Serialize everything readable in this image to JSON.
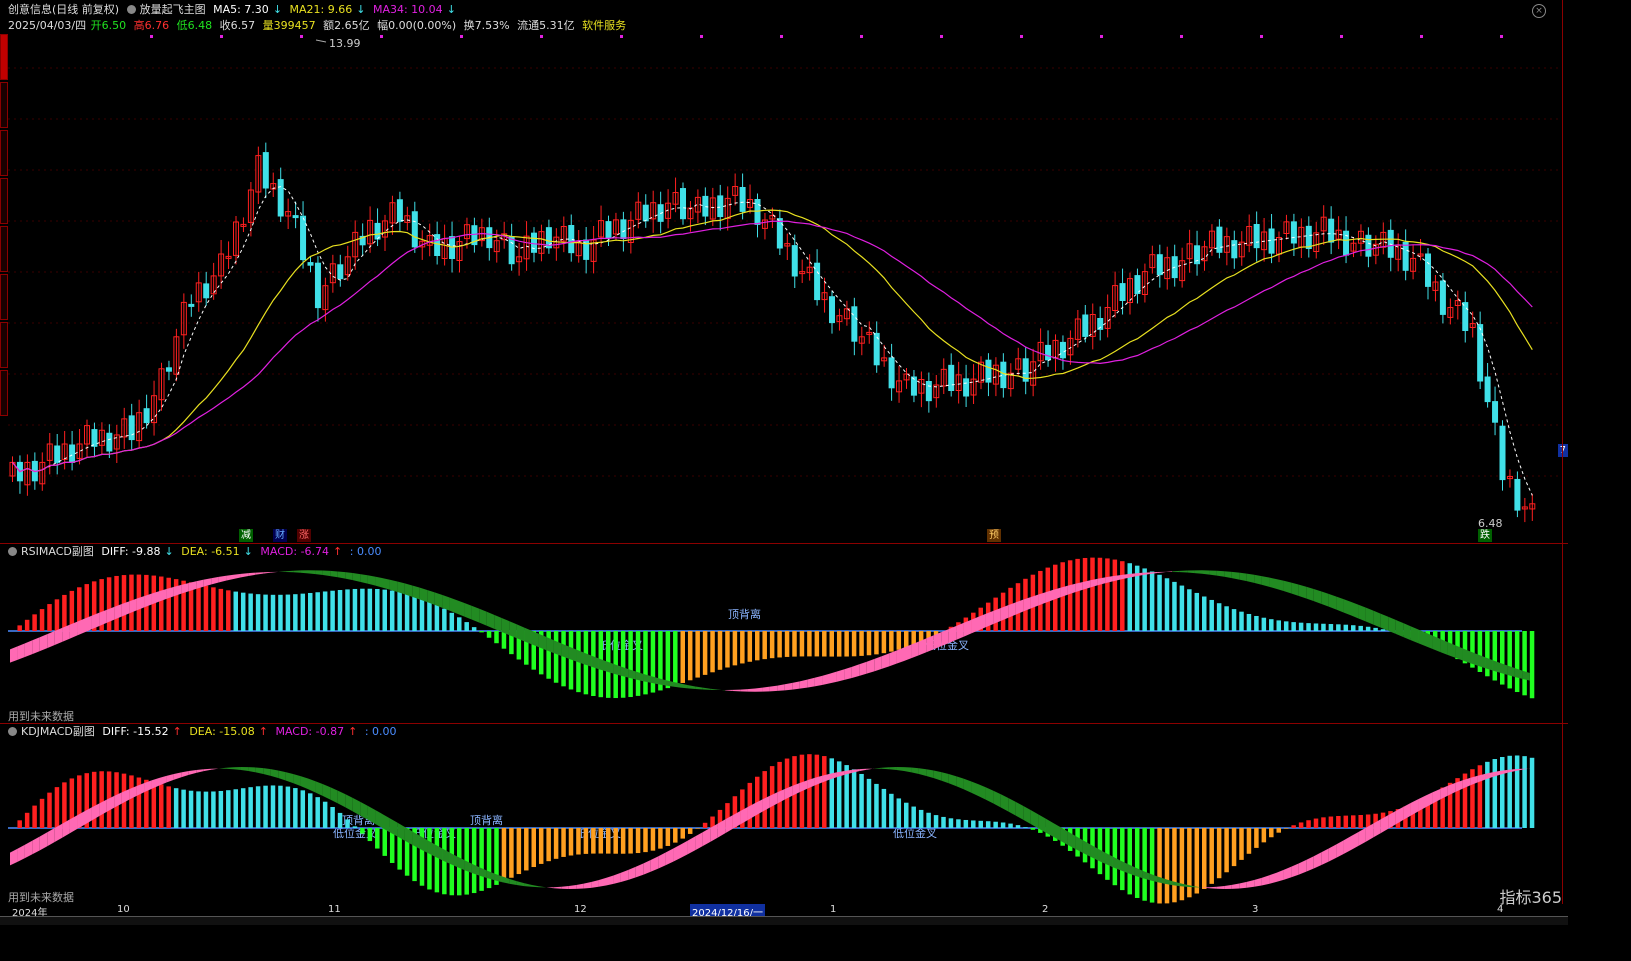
{
  "main": {
    "stock_name": "创意信息(日线 前复权)",
    "indicator_name": "放量起飞主图",
    "ma5": "MA5: 7.30",
    "ma21": "MA21: 9.66",
    "ma34": "MA34: 10.04",
    "date": "2025/04/03/四",
    "open_label": "开",
    "open": "6.50",
    "high_label": "高",
    "high": "6.76",
    "low_label": "低",
    "low": "6.48",
    "close_label": "收",
    "close": "6.57",
    "volume_label": "量",
    "volume": "399457",
    "amount": "额2.65亿",
    "change": "幅0.00(0.00%)",
    "turnover": "换7.53%",
    "float_cap": "流通5.31亿",
    "sector": "软件服务",
    "peak_label": "13.99",
    "last_label": "6.48",
    "price_tag": "7",
    "signal_labels": [
      "减",
      "财",
      "涨",
      "预",
      "跌"
    ]
  },
  "sub1": {
    "name": "RSIMACD副图",
    "diff": "DIFF: -9.88",
    "dea": "DEA: -6.51",
    "macd": "MACD: -6.74",
    "zero": ": 0.00",
    "annotations": [
      "顶背离",
      "低位金叉",
      "低位金叉"
    ],
    "future_note": "用到未来数据"
  },
  "sub2": {
    "name": "KDJMACD副图",
    "diff": "DIFF: -15.52",
    "dea": "DEA: -15.08",
    "macd": "MACD: -0.87",
    "zero": ": 0.00",
    "annotations": [
      "顶背离",
      "低位金叉",
      "低位金叉",
      "顶背离",
      "低位金叉",
      "低位金叉"
    ],
    "future_note": "用到未来数据"
  },
  "xaxis": {
    "labels": [
      "2024年",
      "10",
      "11",
      "12",
      "2024/12/16/一",
      "1",
      "2",
      "3",
      "4"
    ]
  },
  "logo": "指标365",
  "colors": {
    "up": "#ff2020",
    "down": "#40e0e8",
    "ma5": "#ffffff",
    "ma21": "#e8e020",
    "ma34": "#e020e0",
    "diff_fill_up": "#ff69b4",
    "diff_fill_down": "#228b22"
  }
}
